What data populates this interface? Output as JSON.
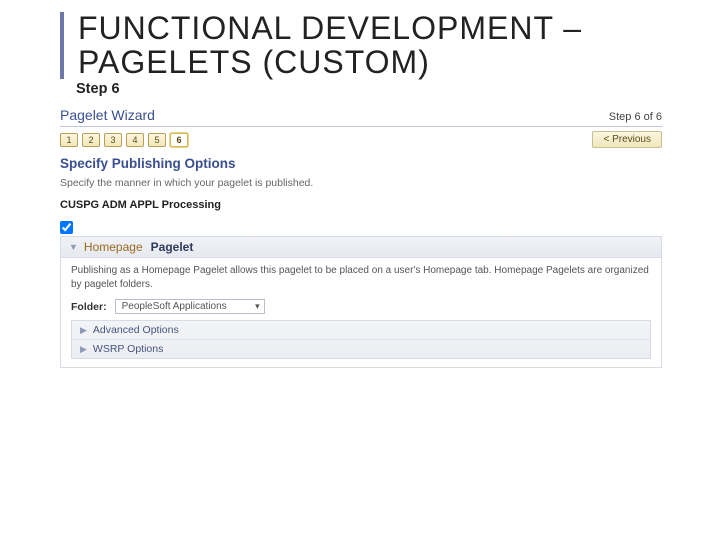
{
  "title": "FUNCTIONAL DEVELOPMENT – PAGELETS (CUSTOM)",
  "step_label": "Step 6",
  "wizard": {
    "title": "Pagelet Wizard",
    "step_of": "Step 6 of 6",
    "steps": [
      "1",
      "2",
      "3",
      "4",
      "5",
      "6"
    ],
    "current": 6,
    "prev_label": "< Previous"
  },
  "section": {
    "title": "Specify Publishing Options",
    "subtitle": "Specify the manner in which your pagelet is published.",
    "proc_label": "CUSPG ADM APPL Processing"
  },
  "homepage": {
    "checked": true,
    "header_prefix": "Homepage",
    "header_word": "Pagelet",
    "desc": "Publishing as a Homepage Pagelet allows this pagelet to be placed on a user's Homepage tab. Homepage Pagelets are organized by pagelet folders.",
    "folder_label": "Folder:",
    "folder_value": "PeopleSoft Applications",
    "advanced_label": "Advanced Options",
    "wsrp_label": "WSRP Options"
  }
}
